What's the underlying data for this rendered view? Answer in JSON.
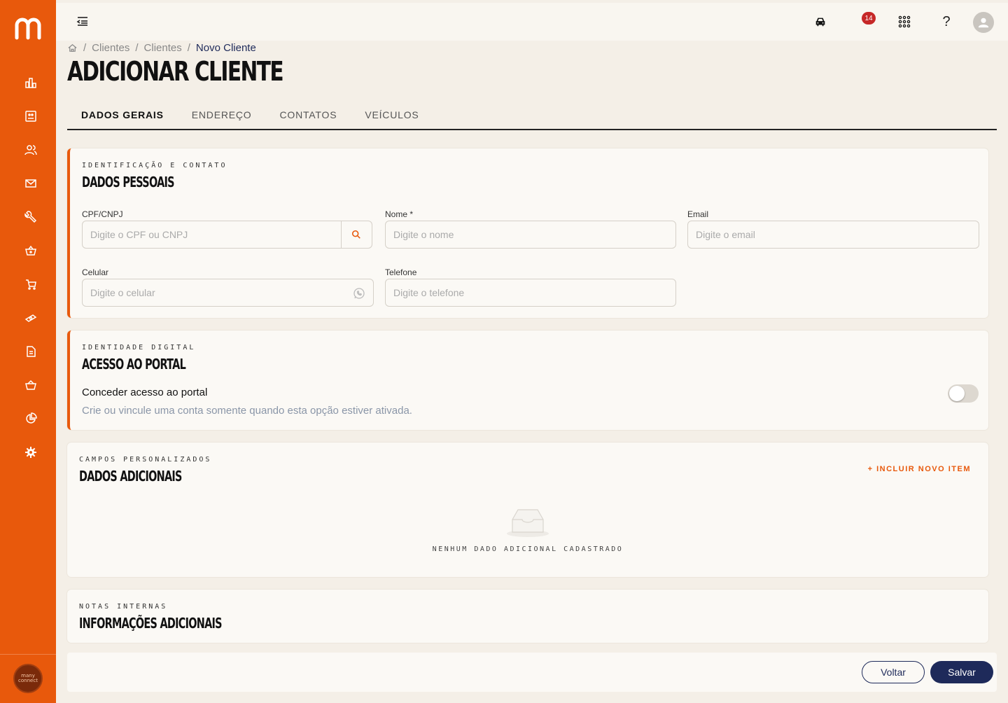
{
  "brand": {
    "name": "m",
    "badge_text": "many connect"
  },
  "topbar": {
    "notification_count": "14",
    "help": "?"
  },
  "breadcrumb": {
    "items": [
      "Clientes",
      "Clientes",
      "Novo Cliente"
    ]
  },
  "page": {
    "title": "ADICIONAR CLIENTE"
  },
  "tabs": [
    {
      "label": "DADOS GERAIS"
    },
    {
      "label": "ENDEREÇO"
    },
    {
      "label": "CONTATOS"
    },
    {
      "label": "VEÍCULOS"
    }
  ],
  "personal": {
    "eyebrow": "IDENTIFICAÇÃO E CONTATO",
    "title": "DADOS PESSOAIS",
    "cpf": {
      "label": "CPF/CNPJ",
      "placeholder": "Digite o CPF ou CNPJ"
    },
    "nome": {
      "label": "Nome",
      "required": "*",
      "placeholder": "Digite o nome"
    },
    "email": {
      "label": "Email",
      "placeholder": "Digite o email"
    },
    "celular": {
      "label": "Celular",
      "placeholder": "Digite o celular"
    },
    "telefone": {
      "label": "Telefone",
      "placeholder": "Digite o telefone"
    }
  },
  "portal": {
    "eyebrow": "IDENTIDADE DIGITAL",
    "title": "ACESSO AO PORTAL",
    "toggle_label": "Conceder acesso ao portal",
    "hint": "Crie ou vincule uma conta somente quando esta opção estiver ativada."
  },
  "additional": {
    "eyebrow": "CAMPOS PERSONALIZADOS",
    "title": "DADOS ADICIONAIS",
    "add_label": "+  INCLUIR NOVO ITEM",
    "empty": "NENHUM DADO ADICIONAL CADASTRADO"
  },
  "notes": {
    "eyebrow": "NOTAS INTERNAS",
    "title": "INFORMAÇÕES ADICIONAIS"
  },
  "footer": {
    "back_label": "Voltar",
    "save_label": "Salvar"
  },
  "colors": {
    "accent": "#e8590c",
    "primary": "#1e2a5a",
    "background": "#f4efe7"
  }
}
